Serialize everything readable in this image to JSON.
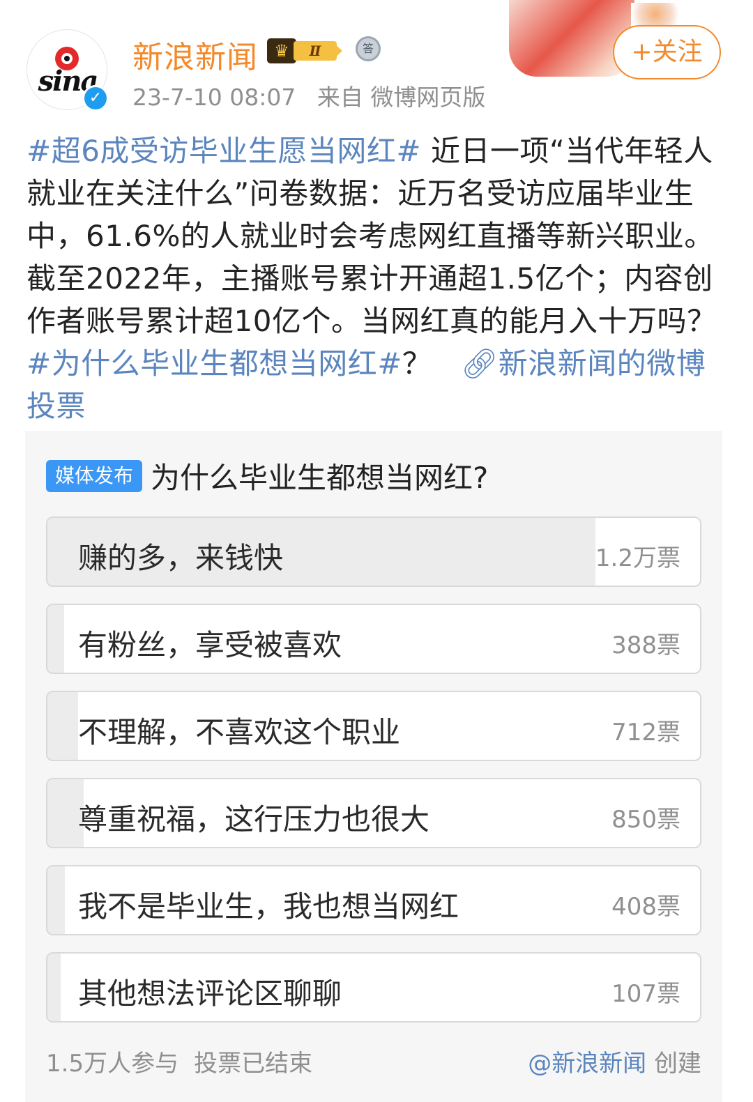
{
  "account": {
    "name": "新浪新闻",
    "avatar_icon": "sina-logo-icon",
    "logo_text": "sina",
    "verified_icon": "verified-check-icon",
    "level_badge": "Ⅱ",
    "medal_text": "答",
    "timestamp": "23-7-10 08:07",
    "source": "来自 微博网页版",
    "follow_label": "+关注"
  },
  "post": {
    "tag1": "#超6成受访毕业生愿当网红#",
    "text1": " 近日一项“当代年轻人就业在关注什么”问卷数据：近万名受访应届毕业生中，61.6%的人就业时会考虑网红直播等新兴职业。截至2022年，主播账号累计开通超1.5亿个；内容创作者账号累计超10亿个。当网红真的能月入十万吗？",
    "tag2": "#为什么毕业生都想当网红#",
    "text2": "？",
    "link_icon": "link-icon",
    "link_text": "新浪新闻的微博投票"
  },
  "poll": {
    "badge": "媒体发布",
    "title": "为什么毕业生都想当网红?",
    "options": [
      {
        "label": "赚的多，来钱快",
        "count": "1.2万票",
        "share": 0.84
      },
      {
        "label": "有粉丝，享受被喜欢",
        "count": "388票",
        "share": 0.026
      },
      {
        "label": "不理解，不喜欢这个职业",
        "count": "712票",
        "share": 0.047
      },
      {
        "label": "尊重祝福，这行压力也很大",
        "count": "850票",
        "share": 0.056
      },
      {
        "label": "我不是毕业生，我也想当网红",
        "count": "408票",
        "share": 0.027
      },
      {
        "label": "其他想法评论区聊聊",
        "count": "107票",
        "share": 0.007
      }
    ],
    "participants": "1.5万人参与",
    "status": "投票已结束",
    "creator": "@新浪新闻",
    "created_label": "创建"
  },
  "colors": {
    "accent": "#f3892a",
    "link": "#5b85be",
    "badge": "#3a97f5"
  }
}
